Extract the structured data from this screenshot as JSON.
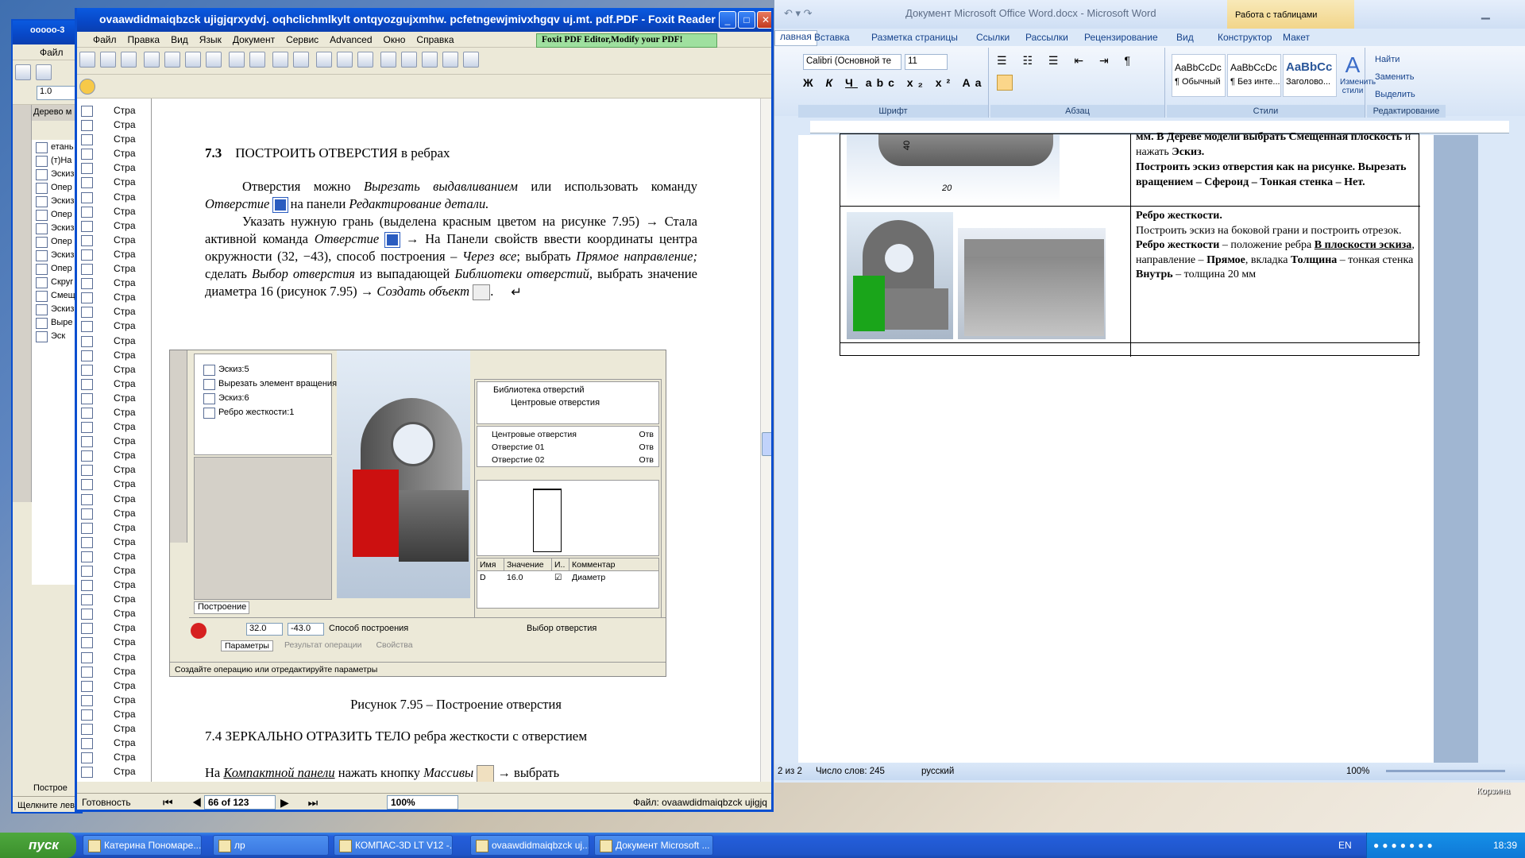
{
  "kompas": {
    "title": "ooooo-3",
    "menu_item": "Файл",
    "zoom": "1.0",
    "tree_header": "Дерево м",
    "tree_items": [
      "етань (Т)",
      "(т)На",
      "Эскиз",
      "Опер",
      "Эскиз",
      "Опер",
      "Эскиз",
      "Опер",
      "Эскиз",
      "Опер",
      "Скруг",
      "Смещ",
      "Эскиз",
      "Выре",
      "Эск"
    ],
    "tab_label": "Построе",
    "status": "Щелкните лев"
  },
  "foxit": {
    "title": "ovaawdidmaiqbzck ujigjqrxydvj. oqhclichmlkylt ontqyozgujxmhw. pcfetngewjmivxhgqv uj.mt. pdf.PDF - Foxit Reader 2.0 ...",
    "menu": [
      "Файл",
      "Правка",
      "Вид",
      "Язык",
      "Документ",
      "Сервис",
      "Advanced",
      "Окно",
      "Справка"
    ],
    "promo": "Foxit PDF Editor,Modify your PDF!",
    "bookmark_label": "Стра",
    "bookmark_count": 47,
    "status_ready": "Готовность",
    "page_indicator": "66 of 123",
    "zoom": "100%",
    "file_label": "Файл: ovaawdidmaiqbzck ujigjq"
  },
  "pdf": {
    "heading_num": "7.3",
    "heading_text": "ПОСТРОИТЬ ОТВЕРСТИЯ  в ребрах",
    "p1_a": "Отверстия можно ",
    "p1_b": "Вырезать выдавливанием",
    "p1_c": " или использовать команду ",
    "p1_d": "Отверстие",
    "p1_e": " на панели ",
    "p1_f": "Редактирование детали.",
    "p2_a": "Указать нужную грань  (выделена красным цветом на рисунке 7.95) → Стала активной команда ",
    "p2_b": "Отверстие",
    "p2_c": " →  На Панели свойств ввести координаты центра окружности  (32, −43), способ построения – ",
    "p2_d": "Через все",
    "p2_e": "; выбрать ",
    "p2_f": "Прямое направление;",
    "p2_g": " сделать ",
    "p2_h": "Выбор отверстия",
    "p2_i": " из выпадающей ",
    "p2_j": "Библиотеки отверстий,",
    "p2_k": " выбрать значение диаметра 16 ",
    "p2_l": "(",
    "p2_m": "рисунок 7.95",
    "p2_n": ") → ",
    "p2_o": "Создать объект",
    "fig_tree": [
      "Эскиз:5",
      "Вырезать элемент вращения:1",
      "Эскиз:6",
      "Ребро жесткости:1"
    ],
    "fig_tab": "Построение",
    "lib_title": "Библиотека отверстий",
    "lib_folder": "Центровые отверстия",
    "lib_list": [
      "Центровые отверстия",
      "Отверстие 01",
      "Отверстие 02"
    ],
    "lib_side": [
      "Отв",
      "Отв",
      "Отв"
    ],
    "param_headers": [
      "Имя",
      "Значение",
      "И..",
      "Комментар"
    ],
    "param_name": "D",
    "param_value": "16.0",
    "param_comment": "Диаметр",
    "coord_x": "32.0",
    "coord_y": "-43.0",
    "method_label": "Способ построения",
    "choose_label": "Выбор отверстия",
    "tabs": [
      "Параметры",
      "Результат операции",
      "Свойства"
    ],
    "fig_status": "Создайте операцию или отредактируйте параметры",
    "caption": "Рисунок 7.95 – Построение отверстия",
    "heading2": "7.4  ЗЕРКАЛЬНО ОТРАЗИТЬ ТЕЛО ребра жесткости с отверстием",
    "p3_a": "На ",
    "p3_b": "Компактной панели",
    "p3_c": " нажать кнопку ",
    "p3_d": "Массивы",
    "p3_e": " → выбрать",
    "dim_40": "40",
    "dim_20": "20"
  },
  "word": {
    "title": "Документ Microsoft Office Word.docx - Microsoft Word",
    "context_tab": "Работа с таблицами",
    "tabs": [
      "лавная",
      "Вставка",
      "Разметка страницы",
      "Ссылки",
      "Рассылки",
      "Рецензирование",
      "Вид",
      "Конструктор",
      "Макет"
    ],
    "font_name": "Calibri (Основной те",
    "font_size": "11",
    "groups": [
      "Шрифт",
      "Абзац",
      "Стили",
      "Редактирование"
    ],
    "styles": [
      {
        "sample": "AaBbCcDc",
        "name": "¶ Обычный"
      },
      {
        "sample": "AaBbCcDc",
        "name": "¶ Без инте..."
      },
      {
        "sample": "AaBbCc",
        "name": "Заголово..."
      }
    ],
    "change_styles": "Изменить стили",
    "edit_items": [
      "Найти",
      "Заменить",
      "Выделить"
    ],
    "cell_top_a": "мм. В Дереве модели выбрать Смещенная плоскость",
    "cell_top_b": " и нажать ",
    "cell_top_c": "Эскиз.",
    "cell_top_d": "Построить эскиз отверстия как на рисунке. Вырезать вращением – Сфероид – Тонкая стенка – Нет.",
    "cell2_title": "Ребро жесткости.",
    "cell2_p1": "Построить эскиз на боковой грани и построить отрезок.",
    "cell2_p2a": "Ребро жесткости",
    "cell2_p2b": " – положение ребра ",
    "cell2_p2c": "В плоскости эскиза",
    "cell2_p2d": ", направление – ",
    "cell2_p2e": "Прямое",
    "cell2_p2f": ", вкладка ",
    "cell2_p2g": "Толщина",
    "cell2_p2h": " – тонкая стенка ",
    "cell2_p2i": "Внутрь",
    "cell2_p2j": " – толщина  20 мм",
    "status_page": "2 из 2",
    "status_words": "Число слов: 245",
    "status_lang": "русский",
    "status_zoom": "100%"
  },
  "taskbar": {
    "start": "пуск",
    "tasks": [
      "Катерина Пономаре...",
      "лр",
      "КОМПАС-3D LT V12 -...",
      "ovaawdidmaiqbzck uj...",
      "Документ Microsoft ..."
    ],
    "lang": "EN",
    "time": "18:39",
    "recycle": "Корзина"
  },
  "colors": {
    "xp_blue": "#0a4fd0",
    "red_face": "#cc1010",
    "green_face": "#1aa51a",
    "ribbon": "#dbe8f8"
  }
}
